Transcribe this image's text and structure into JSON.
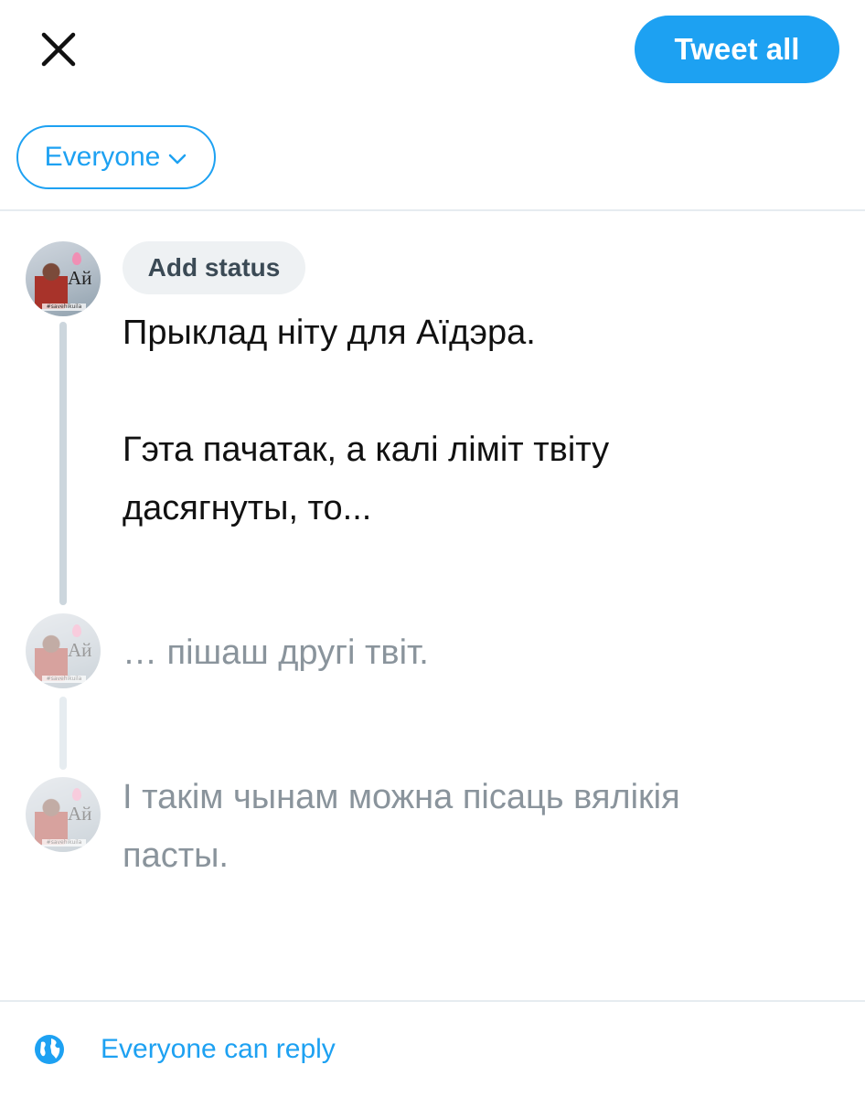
{
  "toolbar": {
    "tweet_all_label": "Tweet all"
  },
  "audience": {
    "label": "Everyone"
  },
  "status": {
    "label": "Add status"
  },
  "avatar": {
    "text": "Ай",
    "tag": "#savehikuila"
  },
  "thread": [
    {
      "text": "Прыклад ніту для Аїдэра.\n\nГэта пачатак, а калі ліміт твіту\nдасягнуты, то..."
    },
    {
      "text": "… пішаш другі твіт."
    },
    {
      "text": "І такім чынам можна пісаць вялікія\nпасты."
    }
  ],
  "reply": {
    "label": "Everyone can reply"
  },
  "colors": {
    "accent": "#1da1f2"
  }
}
